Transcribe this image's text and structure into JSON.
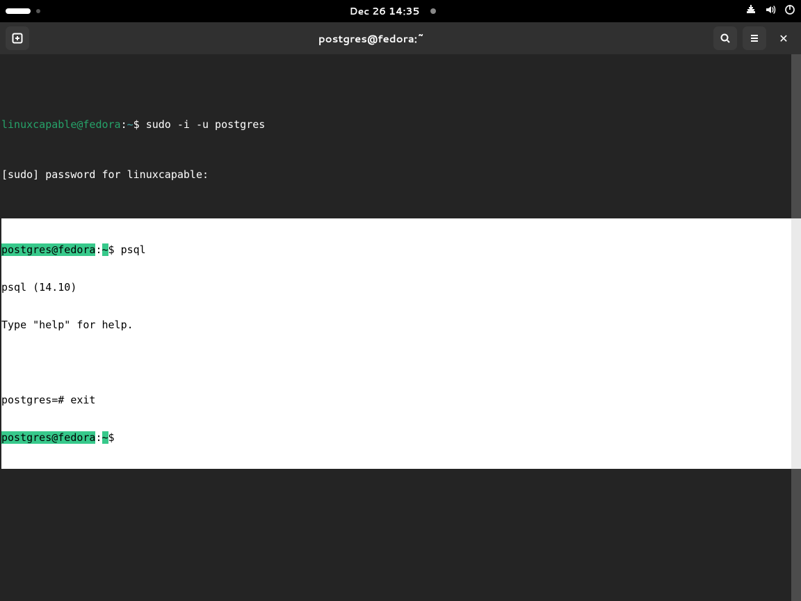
{
  "topbar": {
    "datetime": "Dec 26  14:35"
  },
  "window": {
    "title": "postgres@fedora:~"
  },
  "terminal": {
    "line1": {
      "userhost": "linuxcapable@fedora",
      "sep": ":",
      "dir": "~",
      "prompt": "$ ",
      "cmd": "sudo -i -u postgres"
    },
    "line2": "[sudo] password for linuxcapable:",
    "line3": {
      "userhost": "postgres@fedora",
      "sep": ":",
      "dir": "~",
      "prompt": "$ ",
      "cmd": "psql"
    },
    "line4": "psql (14.10)",
    "line5": "Type \"help\" for help.",
    "line6": "",
    "line7": "postgres=# exit",
    "line8": {
      "userhost": "postgres@fedora",
      "sep": ":",
      "dir": "~",
      "prompt": "$ "
    }
  }
}
